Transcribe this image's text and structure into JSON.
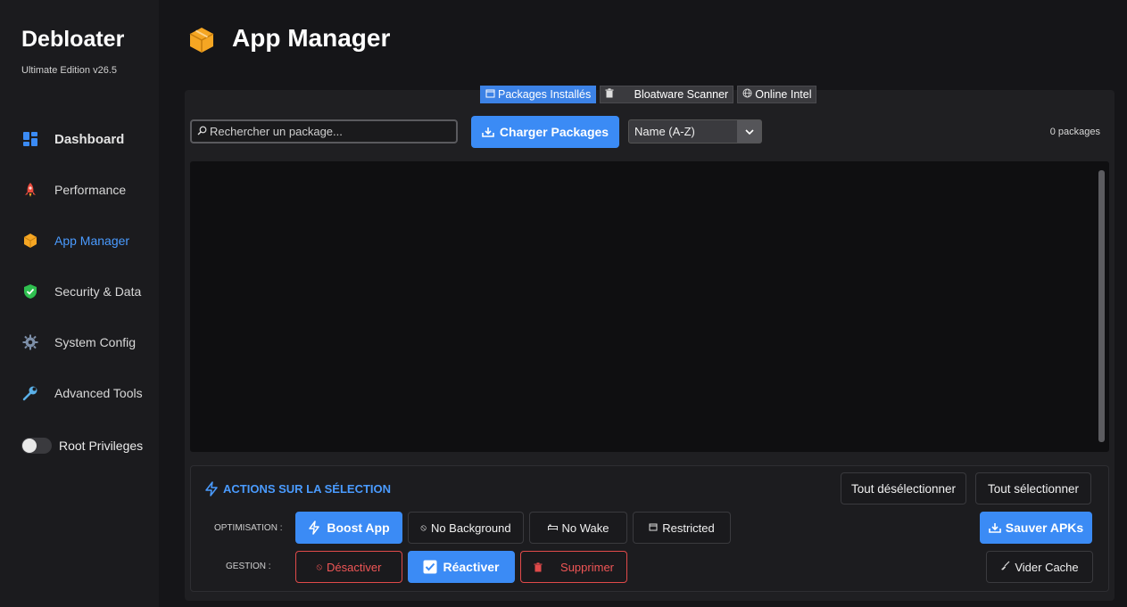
{
  "app": {
    "name": "Debloater",
    "edition": "Ultimate Edition v26.5"
  },
  "sidebar": {
    "items": [
      {
        "label": "Dashboard",
        "icon": "dashboard-grid-icon"
      },
      {
        "label": "Performance",
        "icon": "rocket-icon"
      },
      {
        "label": "App Manager",
        "icon": "package-box-icon",
        "active": true
      },
      {
        "label": "Security & Data",
        "icon": "shield-check-icon"
      },
      {
        "label": "System Config",
        "icon": "gear-icon"
      },
      {
        "label": "Advanced Tools",
        "icon": "wrench-icon"
      }
    ],
    "root_toggle": {
      "label": "Root Privileges",
      "enabled": false
    }
  },
  "header": {
    "title": "App Manager",
    "icon": "package-box-icon"
  },
  "tabs": [
    {
      "label": "Packages Installés",
      "icon": "package-icon",
      "active": true
    },
    {
      "label": "Bloatware Scanner",
      "icon": "trash-icon"
    },
    {
      "label": "Online Intel",
      "icon": "globe-icon"
    }
  ],
  "toolbar": {
    "search_placeholder": "Rechercher un package...",
    "load_label": "Charger Packages",
    "sort_value": "Name (A-Z)",
    "package_count": "0 packages"
  },
  "actions": {
    "title": "ACTIONS SUR LA SÉLECTION",
    "deselect_all": "Tout désélectionner",
    "select_all": "Tout sélectionner",
    "optimisation_label": "OPTIMISATION :",
    "gestion_label": "GESTION :",
    "boost_app": "Boost App",
    "no_background": "No Background",
    "no_wake": "No Wake",
    "restricted": "Restricted",
    "save_apks": "Sauver APKs",
    "disable": "Désactiver",
    "reenable": "Réactiver",
    "delete": "Supprimer",
    "clear_cache": "Vider Cache"
  },
  "colors": {
    "accent": "#3b8bf5",
    "danger": "#e04a4a",
    "background": "#151518",
    "sidebar": "#1b1b1e"
  }
}
